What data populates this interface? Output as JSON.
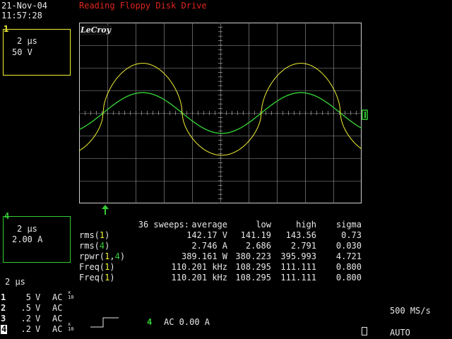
{
  "header": {
    "date": "21-Nov-04",
    "time": "11:57:28",
    "title": "Reading Floppy Disk Drive"
  },
  "channel_boxes": [
    {
      "id": "1",
      "timebase": "2 µs",
      "scale": "50 V",
      "color": "#f2f233"
    },
    {
      "id": "4",
      "timebase": "2 µs",
      "scale": "2.00 A",
      "color": "#33cc33"
    }
  ],
  "logo": "LeCroy",
  "timebase_label": "2 µs",
  "measurements": {
    "header": {
      "sweeps": "36 sweeps:",
      "average": "average",
      "low": "low",
      "high": "high",
      "sigma": "sigma"
    },
    "rows": [
      {
        "label": "rms(",
        "ch": "1",
        "ch2": "",
        "close": ")",
        "avg": "142.17 V",
        "low": "141.19",
        "high": "143.56",
        "sigma": "0.73"
      },
      {
        "label": "rms(",
        "ch": "4",
        "ch2": "",
        "close": ")",
        "avg": "2.746 A",
        "low": "2.686",
        "high": "2.791",
        "sigma": "0.030"
      },
      {
        "label": "rpwr(",
        "ch": "1",
        "ch2": "4",
        "close": ")",
        "avg": "389.161 W",
        "low": "380.223",
        "high": "395.993",
        "sigma": "4.721"
      },
      {
        "label": "Freq(",
        "ch": "1",
        "ch2": "",
        "close": ")",
        "avg": "110.201 kHz",
        "low": "108.295",
        "high": "111.111",
        "sigma": "0.800"
      },
      {
        "label": "Freq(",
        "ch": "1",
        "ch2": "",
        "close": ")",
        "avg": "110.201 kHz",
        "low": "108.295",
        "high": "111.111",
        "sigma": "0.800"
      }
    ]
  },
  "channel_list": [
    {
      "num": "1",
      "volts": "5",
      "unit": "V",
      "coupling": "AC",
      "probe": "x10"
    },
    {
      "num": "2",
      "volts": ".5",
      "unit": "V",
      "coupling": "AC",
      "probe": ""
    },
    {
      "num": "3",
      "volts": ".2",
      "unit": "V",
      "coupling": "AC",
      "probe": ""
    },
    {
      "num": "4",
      "volts": ".2",
      "unit": "V",
      "coupling": "AC",
      "probe": "x10"
    }
  ],
  "trigger": {
    "channel": "4",
    "text": "AC 0.00 A"
  },
  "sample_rate": "500 MS/s",
  "trigger_mode": "AUTO",
  "colors": {
    "ch1": "#f2f233",
    "ch4": "#33cc33",
    "title": "#e0261c",
    "grid": "#9a9a9a"
  },
  "waveforms": {
    "ch1_amplitude_divs": 2.2,
    "ch4_amplitude_divs": 0.9,
    "period_divs": 5.6
  }
}
